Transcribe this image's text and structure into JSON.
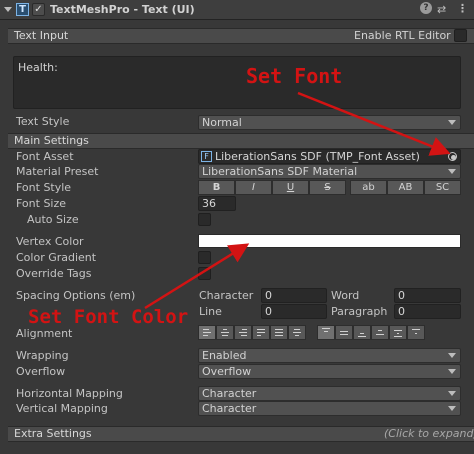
{
  "header": {
    "title": "TextMeshPro - Text (UI)",
    "icon": "text-component-icon"
  },
  "text_input": {
    "section_title": "Text Input",
    "rtl_label": "Enable RTL Editor",
    "value": "Health:"
  },
  "text_style": {
    "label": "Text Style",
    "value": "Normal"
  },
  "main_settings": {
    "section_title": "Main Settings",
    "font_asset_label": "Font Asset",
    "font_asset_value": "LiberationSans SDF (TMP_Font Asset)",
    "material_preset_label": "Material Preset",
    "material_preset_value": "LiberationSans SDF Material",
    "font_style_label": "Font Style",
    "font_style_buttons": [
      "B",
      "I",
      "U",
      "S",
      "ab",
      "AB",
      "SC"
    ],
    "font_size_label": "Font Size",
    "font_size_value": "36",
    "auto_size_label": "Auto Size",
    "vertex_color_label": "Vertex Color",
    "vertex_color_value": "#ffffff",
    "color_gradient_label": "Color Gradient",
    "override_tags_label": "Override Tags",
    "spacing_label": "Spacing Options (em)",
    "character_label": "Character",
    "character_value": "0",
    "word_label": "Word",
    "word_value": "0",
    "line_label": "Line",
    "line_value": "0",
    "paragraph_label": "Paragraph",
    "paragraph_value": "0",
    "alignment_label": "Alignment",
    "wrapping_label": "Wrapping",
    "wrapping_value": "Enabled",
    "overflow_label": "Overflow",
    "overflow_value": "Overflow",
    "horizontal_mapping_label": "Horizontal Mapping",
    "horizontal_mapping_value": "Character",
    "vertical_mapping_label": "Vertical Mapping",
    "vertical_mapping_value": "Character"
  },
  "extra_settings": {
    "section_title": "Extra Settings",
    "hint": "(Click to expand)"
  },
  "annotations": {
    "set_font": "Set Font",
    "set_font_color": "Set Font Color",
    "color": "#d31313"
  }
}
